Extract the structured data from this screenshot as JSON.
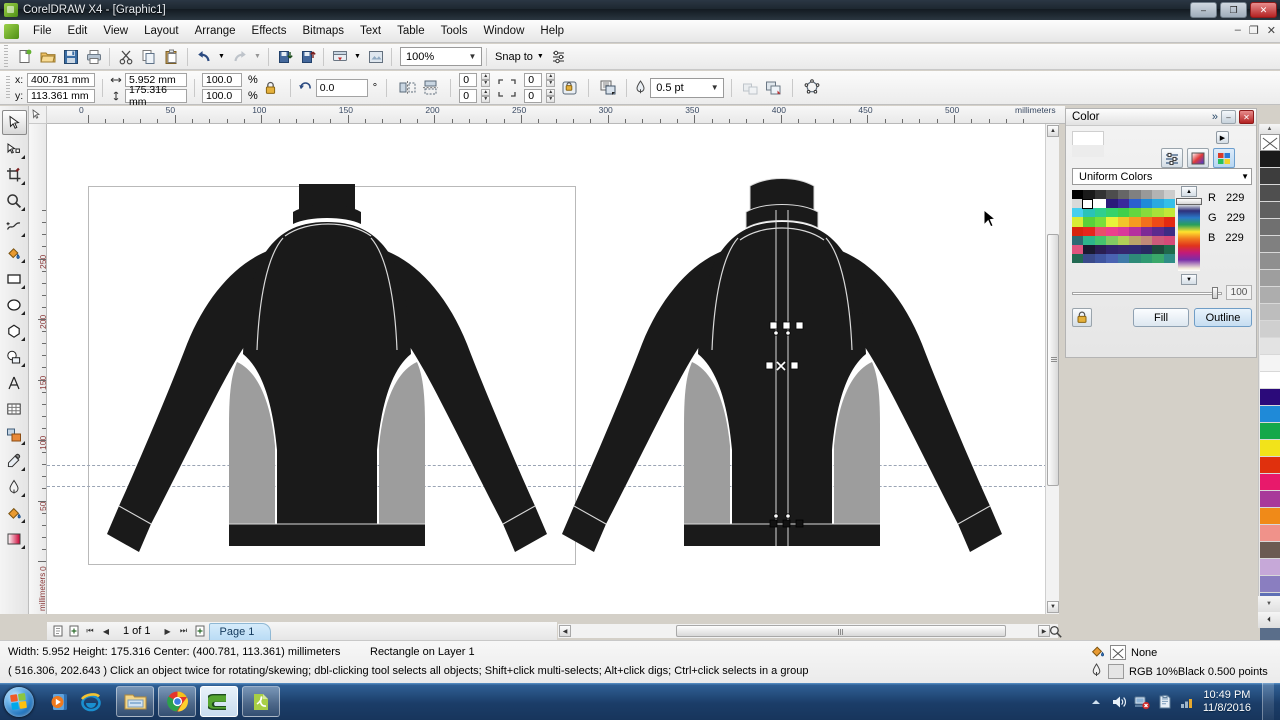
{
  "window": {
    "title": "CorelDRAW X4 - [Graphic1]",
    "minimize": "–",
    "maximize": "❐",
    "close": "✕",
    "doc_minimize": "–",
    "doc_restore": "❐",
    "doc_close": "✕"
  },
  "menubar": {
    "items": [
      {
        "label": "File"
      },
      {
        "label": "Edit"
      },
      {
        "label": "View"
      },
      {
        "label": "Layout"
      },
      {
        "label": "Arrange"
      },
      {
        "label": "Effects"
      },
      {
        "label": "Bitmaps"
      },
      {
        "label": "Text"
      },
      {
        "label": "Table"
      },
      {
        "label": "Tools"
      },
      {
        "label": "Window"
      },
      {
        "label": "Help"
      }
    ]
  },
  "standard_toolbar": {
    "buttons": [
      {
        "name": "new-document-icon",
        "glyph": "὜B"
      },
      {
        "name": "open-document-icon",
        "glyph": ""
      },
      {
        "name": "save-document-icon",
        "glyph": ""
      },
      {
        "name": "print-icon",
        "glyph": ""
      },
      {
        "name": "cut-icon",
        "glyph": "✂"
      },
      {
        "name": "copy-icon",
        "glyph": ""
      },
      {
        "name": "paste-icon",
        "glyph": ""
      },
      {
        "name": "undo-icon",
        "glyph": "↶"
      },
      {
        "name": "redo-icon",
        "glyph": "↷"
      },
      {
        "name": "import-icon",
        "glyph": ""
      },
      {
        "name": "export-icon",
        "glyph": ""
      },
      {
        "name": "application-launcher-icon",
        "glyph": ""
      },
      {
        "name": "corel-online-icon",
        "glyph": ""
      }
    ],
    "zoom_level": "100%",
    "snap_to_label": "Snap to",
    "dropdown_arrow": "▼"
  },
  "property_bar": {
    "x_label": "x:",
    "y_label": "y:",
    "x_value": "400.781 mm",
    "y_value": "113.361 mm",
    "width_value": "5.952 mm",
    "height_value": "175.316 mm",
    "scale_h": "100.0",
    "scale_v": "100.0",
    "percent_symbol": "%",
    "rotation_value": "0.0",
    "degree_symbol": "°",
    "outline_width": "0.5 pt",
    "corner_tl": "0",
    "corner_bl": "0",
    "corner_tr": "0",
    "corner_br": "0",
    "lock_icon": "🔒"
  },
  "toolbox": {
    "tools": [
      {
        "name": "pick-tool",
        "selected": true
      },
      {
        "name": "shape-tool",
        "selected": false
      },
      {
        "name": "crop-tool",
        "selected": false
      },
      {
        "name": "zoom-tool",
        "selected": false
      },
      {
        "name": "freehand-tool",
        "selected": false
      },
      {
        "name": "smart-fill-tool",
        "selected": false
      },
      {
        "name": "rectangle-tool",
        "selected": false
      },
      {
        "name": "ellipse-tool",
        "selected": false
      },
      {
        "name": "polygon-tool",
        "selected": false
      },
      {
        "name": "basic-shapes-tool",
        "selected": false
      },
      {
        "name": "text-tool",
        "selected": false
      },
      {
        "name": "table-tool",
        "selected": false
      },
      {
        "name": "blend-tool",
        "selected": false
      },
      {
        "name": "eyedropper-tool",
        "selected": false
      },
      {
        "name": "outline-tool",
        "selected": false
      },
      {
        "name": "fill-tool",
        "selected": false
      },
      {
        "name": "interactive-fill-tool",
        "selected": false
      }
    ]
  },
  "rulers": {
    "unit_label": "millimeters",
    "unit_label_vertical": "millimeters",
    "h_ticks": [
      "0",
      "50",
      "100",
      "150",
      "200",
      "250",
      "300",
      "350",
      "400",
      "450",
      "500"
    ],
    "v_ticks": [
      "0",
      "50",
      "100",
      "150",
      "200",
      "250"
    ]
  },
  "page_nav": {
    "page_counter": "1 of 1",
    "first_glyph": "⏮",
    "prev_glyph": "◀",
    "next_glyph": "▶",
    "last_glyph": "⏭",
    "add_page_glyph": "+",
    "tab_label": "Page 1"
  },
  "color_docker": {
    "title": "Color",
    "expand_glyph": "»",
    "minimize_glyph": "–",
    "close_glyph": "✕",
    "mode_select": "Uniform Colors",
    "dropdown_arrow": "▼",
    "channels": [
      {
        "label": "R",
        "value": "229"
      },
      {
        "label": "G",
        "value": "229"
      },
      {
        "label": "B",
        "value": "229"
      }
    ],
    "opacity_value": "100",
    "fill_button": "Fill",
    "outline_button": "Outline",
    "up_arrow": "▲",
    "down_arrow": "▼",
    "lock_icon": "🔒",
    "palette_colors": [
      "#000000",
      "#1a1a1a",
      "#333333",
      "#4d4d4d",
      "#666666",
      "#808080",
      "#999999",
      "#b3b3b3",
      "#cccccc",
      "#d9d9d9",
      "#ffffff",
      "#ffffff",
      "#2b1b7a",
      "#3a2a9c",
      "#2b5fd0",
      "#1f8ad8",
      "#2aa9e0",
      "#34bfe8",
      "#46cff0",
      "#2ac3b8",
      "#2ecf8f",
      "#35d36a",
      "#3fd04b",
      "#63d63f",
      "#86dc3c",
      "#a7e23a",
      "#c2e838",
      "#d8ec36",
      "#5ad13a",
      "#79de3a",
      "#e8f23a",
      "#f2c62a",
      "#f59b22",
      "#f2701c",
      "#ee4a18",
      "#e32a12",
      "#d8240f",
      "#e5261c",
      "#ea4d6a",
      "#ec3f8c",
      "#d93a9a",
      "#b5309e",
      "#7c2a96",
      "#5b2a8e",
      "#3c2c84",
      "#2d6b74",
      "#2eb58c",
      "#45c36e",
      "#82ca62",
      "#b0cf57",
      "#b9a56a",
      "#c08a78",
      "#cc5a7a",
      "#d64a78",
      "#e0547e",
      "#1a1a30",
      "#2a1f52",
      "#30256a",
      "#35276e",
      "#2f2a72",
      "#282a62",
      "#1d4a3c",
      "#1f6a4a",
      "#226a52",
      "#3a4a8a",
      "#3f55a0",
      "#4a63b2",
      "#3f7aa8",
      "#2e8a78",
      "#2f9a72",
      "#3aa86a",
      "#2f8d86",
      "#2e7a9a"
    ],
    "ramp_marker": "ramp-slider-handle"
  },
  "right_palette": {
    "scroll_up": "▲",
    "scroll_down": "▼",
    "expand": "⏴",
    "none_label": "None",
    "colors": [
      "#1a1a1a",
      "#3d3d3d",
      "#4f4f4f",
      "#606060",
      "#707070",
      "#808080",
      "#8f8f8f",
      "#9e9e9e",
      "#adadad",
      "#bdbdbd",
      "#cfcfcf",
      "#e3e3e3",
      "#f4f4f4",
      "#ffffff",
      "#2b0a7a",
      "#1f8ad8",
      "#14a84a",
      "#f2e31a",
      "#e0300d",
      "#e8196b",
      "#a8399a",
      "#f08a18",
      "#f0928a",
      "#6b5b52",
      "#c6a8d8",
      "#8a7ec0",
      "#5e6fb5",
      "#4a5f9e",
      "#5a6e8a"
    ]
  },
  "status_bar": {
    "dimensions": "Width: 5.952  Height: 175.316  Center: (400.781, 113.361)  millimeters",
    "object_info": "Rectangle on Layer 1",
    "coordinates": "( 516.306, 202.643 )",
    "hint": "Click an object twice for rotating/skewing; dbl-clicking tool selects all objects; Shift+click multi-selects; Alt+click digs; Ctrl+click selects in a group",
    "fill_label": "None",
    "outline_label": "RGB 10%Black  0.500 points"
  },
  "taskbar": {
    "start_label": "start-orb",
    "quick_launch": [
      {
        "name": "windows-media-player-icon"
      },
      {
        "name": "internet-explorer-icon"
      }
    ],
    "tasks": [
      {
        "name": "windows-explorer-task"
      },
      {
        "name": "google-chrome-task"
      },
      {
        "name": "coreldraw-task"
      },
      {
        "name": "nitro-pdf-task"
      }
    ],
    "tray": [
      {
        "name": "show-hidden-icons-arrow",
        "glyph": "▲"
      },
      {
        "name": "volume-icon"
      },
      {
        "name": "network-error-icon"
      },
      {
        "name": "action-center-icon"
      },
      {
        "name": "signal-bars-icon"
      }
    ],
    "clock_time": "10:49 PM",
    "clock_date": "11/8/2016"
  },
  "artwork": {
    "description": "jacket-technical-flat-back-and-front",
    "body_color": "#1a1a1a",
    "panel_color": "#9d9d9d",
    "stitch_color": "#d9d9d9",
    "views": [
      {
        "name": "jacket-back-view"
      },
      {
        "name": "jacket-front-view"
      }
    ]
  },
  "selection": {
    "description": "vertical-zipper-rectangle-selected",
    "handle_color": "#ffffff",
    "center_marker": "✕"
  }
}
